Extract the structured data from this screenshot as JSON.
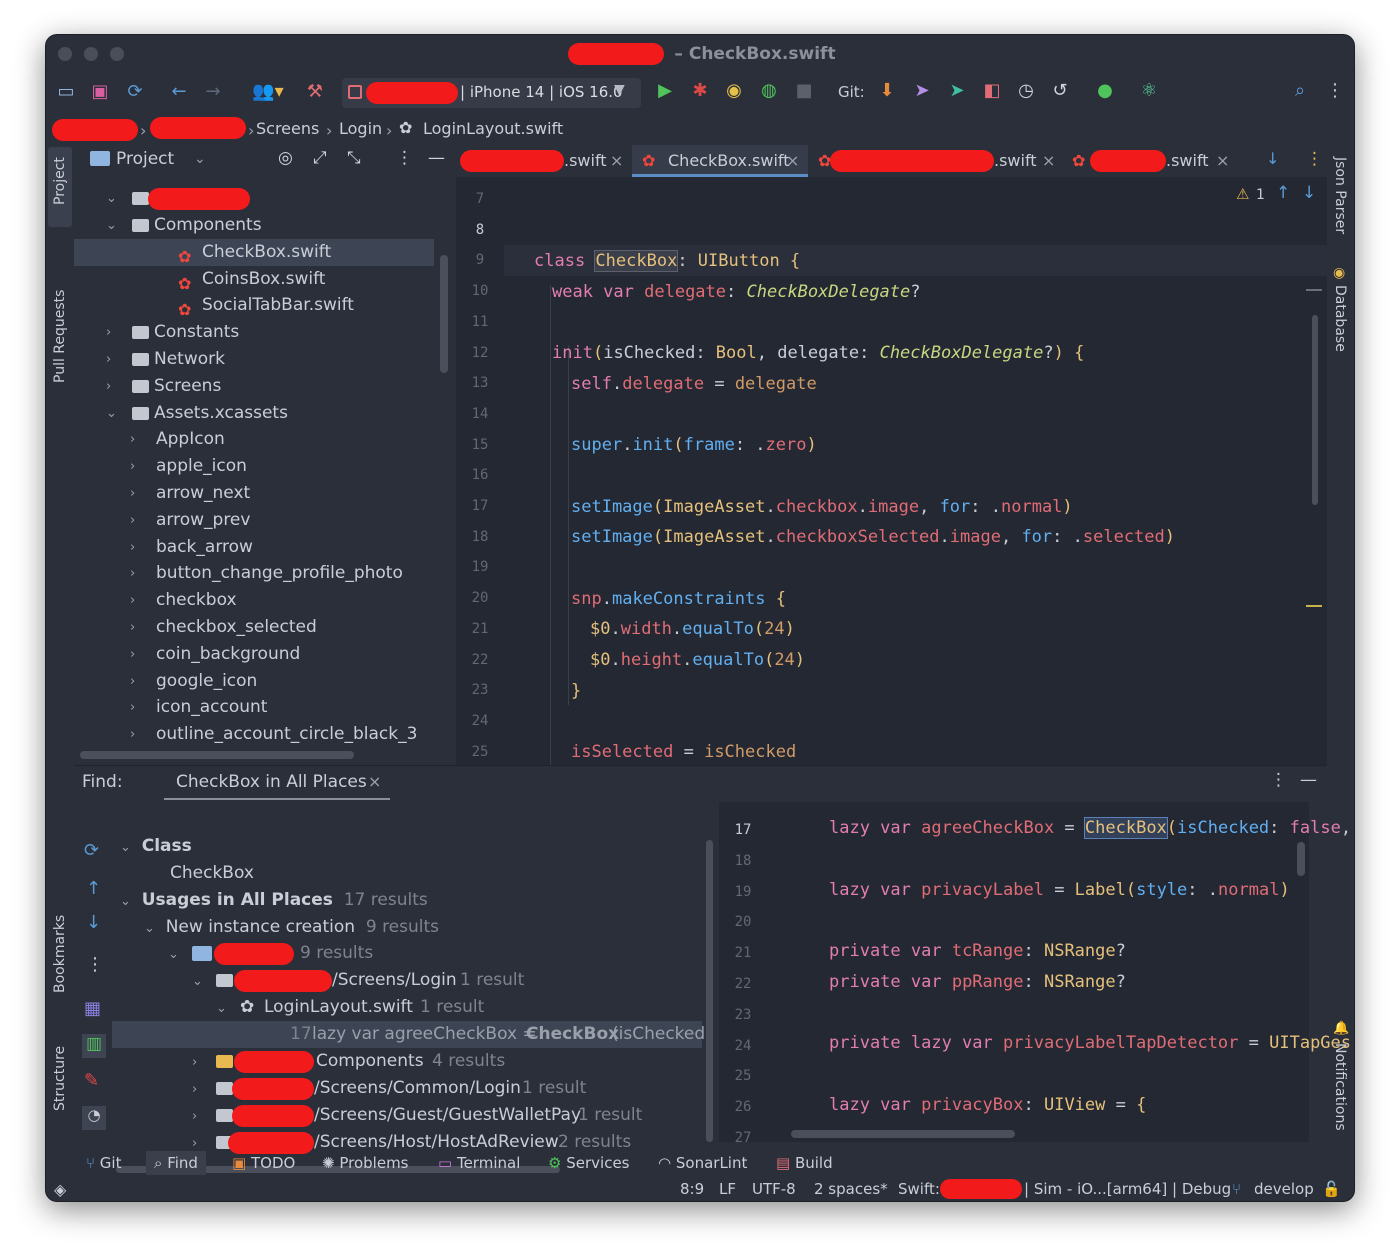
{
  "window": {
    "title": "– CheckBox.swift"
  },
  "toolbar": {
    "device": "| iPhone 14 | iOS 16.0",
    "git_label": "Git:"
  },
  "breadcrumbs": {
    "items": [
      "Screens",
      "Login",
      "LoginLayout.swift"
    ]
  },
  "left_strip": {
    "project": "Project",
    "pull_requests": "Pull Requests",
    "bookmarks": "Bookmarks",
    "structure": "Structure"
  },
  "right_strip": {
    "json_parser": "Json Parser",
    "database": "Database",
    "notifications": "Notifications"
  },
  "project_panel": {
    "title": "Project",
    "tree": [
      {
        "label": "Components",
        "kind": "folder",
        "indent": 1,
        "expanded": true
      },
      {
        "label": "CheckBox.swift",
        "kind": "swift",
        "indent": 2,
        "selected": true
      },
      {
        "label": "CoinsBox.swift",
        "kind": "swift",
        "indent": 2
      },
      {
        "label": "SocialTabBar.swift",
        "kind": "swift",
        "indent": 2
      },
      {
        "label": "Constants",
        "kind": "folder",
        "indent": 1,
        "expanded": false
      },
      {
        "label": "Network",
        "kind": "folder",
        "indent": 1,
        "expanded": false
      },
      {
        "label": "Screens",
        "kind": "folder",
        "indent": 1,
        "expanded": false
      },
      {
        "label": "Assets.xcassets",
        "kind": "assets",
        "indent": 1,
        "expanded": true
      },
      {
        "label": "AppIcon",
        "kind": "item",
        "indent": 2
      },
      {
        "label": "apple_icon",
        "kind": "item",
        "indent": 2
      },
      {
        "label": "arrow_next",
        "kind": "item",
        "indent": 2
      },
      {
        "label": "arrow_prev",
        "kind": "item",
        "indent": 2
      },
      {
        "label": "back_arrow",
        "kind": "item",
        "indent": 2
      },
      {
        "label": "button_change_profile_photo",
        "kind": "item",
        "indent": 2
      },
      {
        "label": "checkbox",
        "kind": "item",
        "indent": 2
      },
      {
        "label": "checkbox_selected",
        "kind": "item",
        "indent": 2
      },
      {
        "label": "coin_background",
        "kind": "item",
        "indent": 2
      },
      {
        "label": "google_icon",
        "kind": "item",
        "indent": 2
      },
      {
        "label": "icon_account",
        "kind": "item",
        "indent": 2
      },
      {
        "label": "outline_account_circle_black_3",
        "kind": "item",
        "indent": 2
      }
    ]
  },
  "editor": {
    "tabs": [
      {
        "label": ".swift",
        "active": false
      },
      {
        "label": "CheckBox.swift",
        "active": true
      },
      {
        "label": ".swift",
        "active": false
      },
      {
        "label": ".swift",
        "active": false
      }
    ],
    "warning_count": "1",
    "line_numbers": [
      "7",
      "8",
      "9",
      "10",
      "11",
      "12",
      "13",
      "14",
      "15",
      "16",
      "17",
      "18",
      "19",
      "20",
      "21",
      "22",
      "23",
      "24",
      "25"
    ]
  },
  "find": {
    "label": "Find:",
    "tab": "CheckBox in All Places",
    "rows": {
      "class": "Class",
      "class_item": "CheckBox",
      "usages": "Usages in All Places",
      "usages_count": "17 results",
      "new_instance": "New instance creation",
      "new_instance_count": "9 results",
      "group_count": "9 results",
      "screens_login": "/Screens/Login",
      "screens_login_count": "1 result",
      "login_layout": "LoginLayout.swift",
      "login_layout_count": "1 result",
      "match_line": "17",
      "match_pre": "lazy var agreeCheckBox = ",
      "match_bold": "CheckBox",
      "match_post": "(isChecked",
      "components": "Components",
      "components_count": "4 results",
      "common_login": "/Screens/Common/Login",
      "common_login_count": "1 result",
      "guest_wallet": "/Screens/Guest/GuestWalletPay",
      "guest_wallet_count": "1 result",
      "host_ad": "/Screens/Host/HostAdReview",
      "host_ad_count": "2 results"
    },
    "preview_line_numbers": [
      "17",
      "18",
      "19",
      "20",
      "21",
      "22",
      "23",
      "24",
      "25",
      "26",
      "27"
    ]
  },
  "bottom_tabs": [
    "Git",
    "Find",
    "TODO",
    "Problems",
    "Terminal",
    "Services",
    "SonarLint",
    "Build"
  ],
  "status": {
    "position": "8:9",
    "line_sep": "LF",
    "encoding": "UTF-8",
    "indent": "2 spaces*",
    "swift": "Swift:",
    "scheme": "| Sim - iO...[arm64] | Debug",
    "branch": "develop"
  }
}
